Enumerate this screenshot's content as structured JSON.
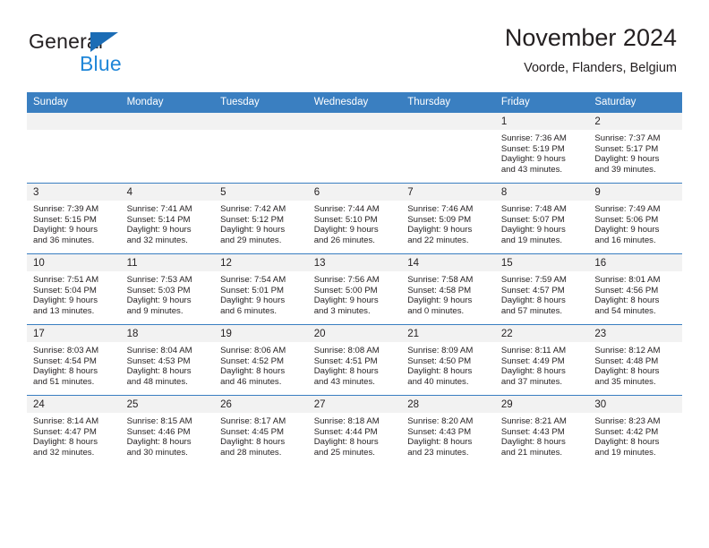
{
  "brand": {
    "name_part1": "General",
    "name_part2": "Blue",
    "logo_icon": "blue-triangle-icon",
    "accent_color": "#1b6cb5",
    "secondary_color": "#1f86d8"
  },
  "header": {
    "title": "November 2024",
    "location": "Voorde, Flanders, Belgium"
  },
  "calendar": {
    "header_background": "#3a7fc1",
    "daynum_background": "#f2f2f2",
    "weekday_names": [
      "Sunday",
      "Monday",
      "Tuesday",
      "Wednesday",
      "Thursday",
      "Friday",
      "Saturday"
    ],
    "weeks": [
      [
        {
          "day": "",
          "empty": true
        },
        {
          "day": "",
          "empty": true
        },
        {
          "day": "",
          "empty": true
        },
        {
          "day": "",
          "empty": true
        },
        {
          "day": "",
          "empty": true
        },
        {
          "day": "1",
          "sunrise": "Sunrise: 7:36 AM",
          "sunset": "Sunset: 5:19 PM",
          "daylight1": "Daylight: 9 hours",
          "daylight2": "and 43 minutes."
        },
        {
          "day": "2",
          "sunrise": "Sunrise: 7:37 AM",
          "sunset": "Sunset: 5:17 PM",
          "daylight1": "Daylight: 9 hours",
          "daylight2": "and 39 minutes."
        }
      ],
      [
        {
          "day": "3",
          "sunrise": "Sunrise: 7:39 AM",
          "sunset": "Sunset: 5:15 PM",
          "daylight1": "Daylight: 9 hours",
          "daylight2": "and 36 minutes."
        },
        {
          "day": "4",
          "sunrise": "Sunrise: 7:41 AM",
          "sunset": "Sunset: 5:14 PM",
          "daylight1": "Daylight: 9 hours",
          "daylight2": "and 32 minutes."
        },
        {
          "day": "5",
          "sunrise": "Sunrise: 7:42 AM",
          "sunset": "Sunset: 5:12 PM",
          "daylight1": "Daylight: 9 hours",
          "daylight2": "and 29 minutes."
        },
        {
          "day": "6",
          "sunrise": "Sunrise: 7:44 AM",
          "sunset": "Sunset: 5:10 PM",
          "daylight1": "Daylight: 9 hours",
          "daylight2": "and 26 minutes."
        },
        {
          "day": "7",
          "sunrise": "Sunrise: 7:46 AM",
          "sunset": "Sunset: 5:09 PM",
          "daylight1": "Daylight: 9 hours",
          "daylight2": "and 22 minutes."
        },
        {
          "day": "8",
          "sunrise": "Sunrise: 7:48 AM",
          "sunset": "Sunset: 5:07 PM",
          "daylight1": "Daylight: 9 hours",
          "daylight2": "and 19 minutes."
        },
        {
          "day": "9",
          "sunrise": "Sunrise: 7:49 AM",
          "sunset": "Sunset: 5:06 PM",
          "daylight1": "Daylight: 9 hours",
          "daylight2": "and 16 minutes."
        }
      ],
      [
        {
          "day": "10",
          "sunrise": "Sunrise: 7:51 AM",
          "sunset": "Sunset: 5:04 PM",
          "daylight1": "Daylight: 9 hours",
          "daylight2": "and 13 minutes."
        },
        {
          "day": "11",
          "sunrise": "Sunrise: 7:53 AM",
          "sunset": "Sunset: 5:03 PM",
          "daylight1": "Daylight: 9 hours",
          "daylight2": "and 9 minutes."
        },
        {
          "day": "12",
          "sunrise": "Sunrise: 7:54 AM",
          "sunset": "Sunset: 5:01 PM",
          "daylight1": "Daylight: 9 hours",
          "daylight2": "and 6 minutes."
        },
        {
          "day": "13",
          "sunrise": "Sunrise: 7:56 AM",
          "sunset": "Sunset: 5:00 PM",
          "daylight1": "Daylight: 9 hours",
          "daylight2": "and 3 minutes."
        },
        {
          "day": "14",
          "sunrise": "Sunrise: 7:58 AM",
          "sunset": "Sunset: 4:58 PM",
          "daylight1": "Daylight: 9 hours",
          "daylight2": "and 0 minutes."
        },
        {
          "day": "15",
          "sunrise": "Sunrise: 7:59 AM",
          "sunset": "Sunset: 4:57 PM",
          "daylight1": "Daylight: 8 hours",
          "daylight2": "and 57 minutes."
        },
        {
          "day": "16",
          "sunrise": "Sunrise: 8:01 AM",
          "sunset": "Sunset: 4:56 PM",
          "daylight1": "Daylight: 8 hours",
          "daylight2": "and 54 minutes."
        }
      ],
      [
        {
          "day": "17",
          "sunrise": "Sunrise: 8:03 AM",
          "sunset": "Sunset: 4:54 PM",
          "daylight1": "Daylight: 8 hours",
          "daylight2": "and 51 minutes."
        },
        {
          "day": "18",
          "sunrise": "Sunrise: 8:04 AM",
          "sunset": "Sunset: 4:53 PM",
          "daylight1": "Daylight: 8 hours",
          "daylight2": "and 48 minutes."
        },
        {
          "day": "19",
          "sunrise": "Sunrise: 8:06 AM",
          "sunset": "Sunset: 4:52 PM",
          "daylight1": "Daylight: 8 hours",
          "daylight2": "and 46 minutes."
        },
        {
          "day": "20",
          "sunrise": "Sunrise: 8:08 AM",
          "sunset": "Sunset: 4:51 PM",
          "daylight1": "Daylight: 8 hours",
          "daylight2": "and 43 minutes."
        },
        {
          "day": "21",
          "sunrise": "Sunrise: 8:09 AM",
          "sunset": "Sunset: 4:50 PM",
          "daylight1": "Daylight: 8 hours",
          "daylight2": "and 40 minutes."
        },
        {
          "day": "22",
          "sunrise": "Sunrise: 8:11 AM",
          "sunset": "Sunset: 4:49 PM",
          "daylight1": "Daylight: 8 hours",
          "daylight2": "and 37 minutes."
        },
        {
          "day": "23",
          "sunrise": "Sunrise: 8:12 AM",
          "sunset": "Sunset: 4:48 PM",
          "daylight1": "Daylight: 8 hours",
          "daylight2": "and 35 minutes."
        }
      ],
      [
        {
          "day": "24",
          "sunrise": "Sunrise: 8:14 AM",
          "sunset": "Sunset: 4:47 PM",
          "daylight1": "Daylight: 8 hours",
          "daylight2": "and 32 minutes."
        },
        {
          "day": "25",
          "sunrise": "Sunrise: 8:15 AM",
          "sunset": "Sunset: 4:46 PM",
          "daylight1": "Daylight: 8 hours",
          "daylight2": "and 30 minutes."
        },
        {
          "day": "26",
          "sunrise": "Sunrise: 8:17 AM",
          "sunset": "Sunset: 4:45 PM",
          "daylight1": "Daylight: 8 hours",
          "daylight2": "and 28 minutes."
        },
        {
          "day": "27",
          "sunrise": "Sunrise: 8:18 AM",
          "sunset": "Sunset: 4:44 PM",
          "daylight1": "Daylight: 8 hours",
          "daylight2": "and 25 minutes."
        },
        {
          "day": "28",
          "sunrise": "Sunrise: 8:20 AM",
          "sunset": "Sunset: 4:43 PM",
          "daylight1": "Daylight: 8 hours",
          "daylight2": "and 23 minutes."
        },
        {
          "day": "29",
          "sunrise": "Sunrise: 8:21 AM",
          "sunset": "Sunset: 4:43 PM",
          "daylight1": "Daylight: 8 hours",
          "daylight2": "and 21 minutes."
        },
        {
          "day": "30",
          "sunrise": "Sunrise: 8:23 AM",
          "sunset": "Sunset: 4:42 PM",
          "daylight1": "Daylight: 8 hours",
          "daylight2": "and 19 minutes."
        }
      ]
    ]
  }
}
